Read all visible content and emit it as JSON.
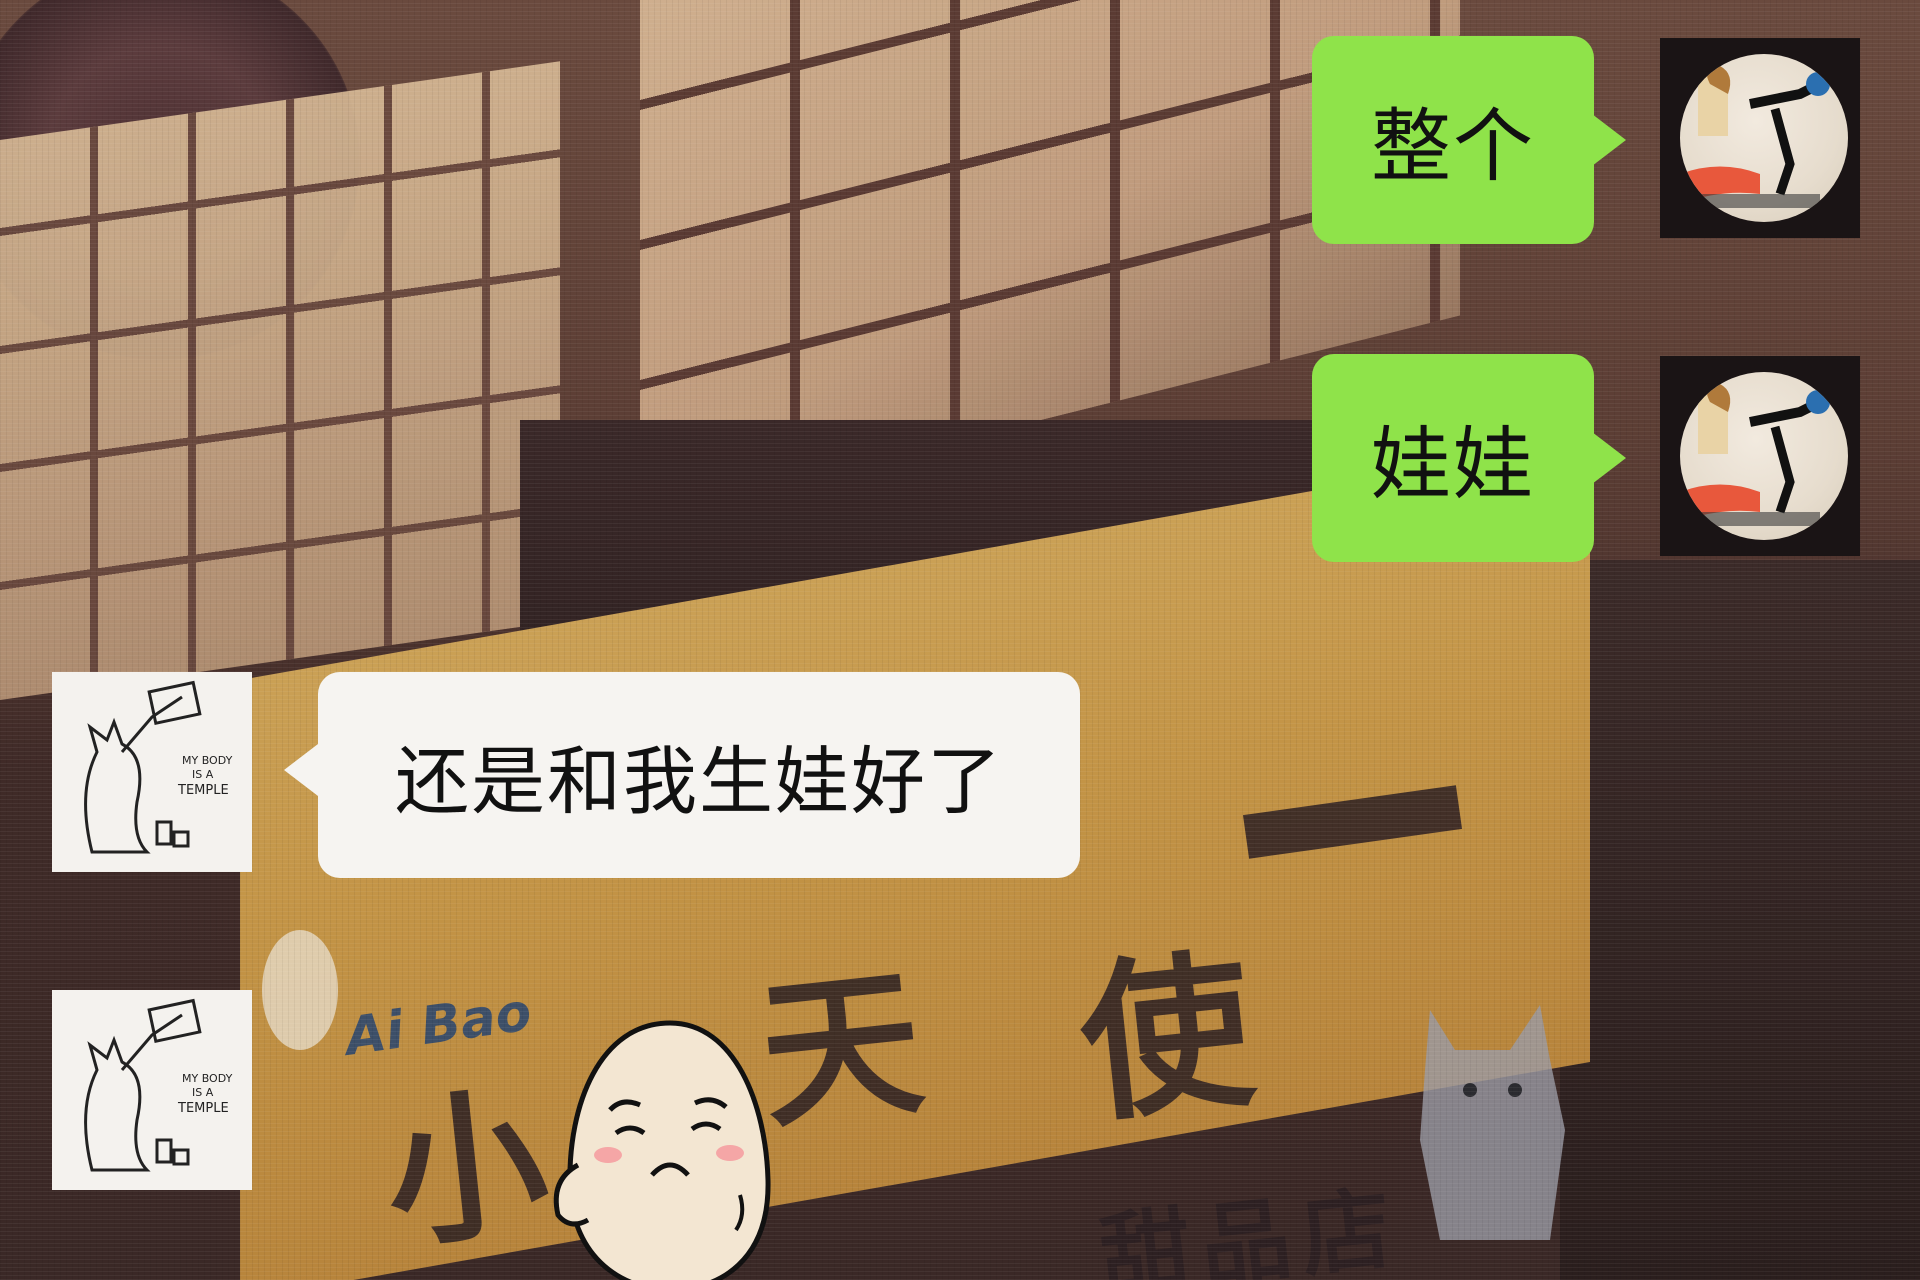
{
  "conversation": {
    "messages": [
      {
        "sender": "self",
        "text": "整个",
        "avatar_icon": "person-illustration-avatar"
      },
      {
        "sender": "self",
        "text": "娃娃",
        "avatar_icon": "person-illustration-avatar"
      },
      {
        "sender": "other",
        "text": "还是和我生娃好了",
        "avatar_icon": "cat-sketch-avatar",
        "avatar_caption": "MY BODY IS A TEMPLE"
      },
      {
        "sender": "other",
        "type": "sticker",
        "sticker_icon": "sad-egg-face-sticker",
        "avatar_icon": "cat-sketch-avatar",
        "avatar_caption": "MY BODY IS A TEMPLE"
      }
    ]
  },
  "background": {
    "sign_chars": [
      "小",
      "天",
      "使",
      "甜",
      "品",
      "店"
    ],
    "sign_logo": "Ai Bao"
  },
  "colors": {
    "self_bubble": "#8fe34a",
    "other_bubble": "#f6f4f1",
    "text": "#111111"
  }
}
